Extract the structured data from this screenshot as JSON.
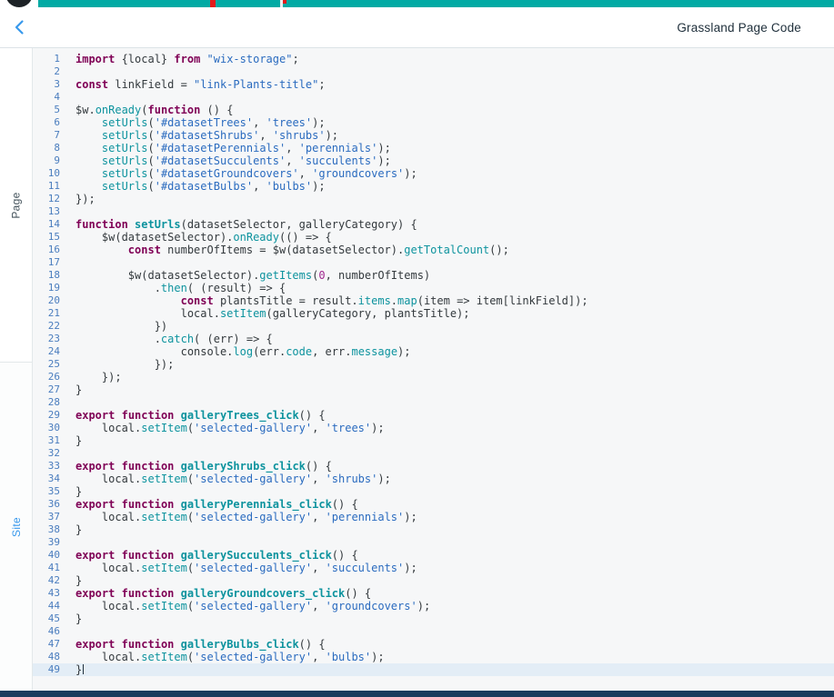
{
  "header": {
    "title": "Grassland Page Code",
    "back_icon": "chevron-left"
  },
  "sidebar": {
    "tabs": [
      {
        "label": "Page",
        "active": true
      },
      {
        "label": "Site",
        "active": false
      }
    ]
  },
  "editor": {
    "active_line": 49,
    "lines": [
      [
        [
          "k",
          "import"
        ],
        [
          "d",
          " {local} "
        ],
        [
          "k",
          "from"
        ],
        [
          "d",
          " "
        ],
        [
          "s",
          "\"wix-storage\""
        ],
        [
          "d",
          ";"
        ]
      ],
      [],
      [
        [
          "k",
          "const"
        ],
        [
          "d",
          " linkField = "
        ],
        [
          "s",
          "\"link-Plants-title\""
        ],
        [
          "d",
          ";"
        ]
      ],
      [],
      [
        [
          "d",
          "$w."
        ],
        [
          "f",
          "onReady"
        ],
        [
          "d",
          "("
        ],
        [
          "k",
          "function"
        ],
        [
          "d",
          " () {"
        ]
      ],
      [
        [
          "d",
          "    "
        ],
        [
          "f",
          "setUrls"
        ],
        [
          "d",
          "("
        ],
        [
          "s",
          "'#datasetTrees'"
        ],
        [
          "d",
          ", "
        ],
        [
          "s",
          "'trees'"
        ],
        [
          "d",
          ");"
        ]
      ],
      [
        [
          "d",
          "    "
        ],
        [
          "f",
          "setUrls"
        ],
        [
          "d",
          "("
        ],
        [
          "s",
          "'#datasetShrubs'"
        ],
        [
          "d",
          ", "
        ],
        [
          "s",
          "'shrubs'"
        ],
        [
          "d",
          ");"
        ]
      ],
      [
        [
          "d",
          "    "
        ],
        [
          "f",
          "setUrls"
        ],
        [
          "d",
          "("
        ],
        [
          "s",
          "'#datasetPerennials'"
        ],
        [
          "d",
          ", "
        ],
        [
          "s",
          "'perennials'"
        ],
        [
          "d",
          ");"
        ]
      ],
      [
        [
          "d",
          "    "
        ],
        [
          "f",
          "setUrls"
        ],
        [
          "d",
          "("
        ],
        [
          "s",
          "'#datasetSucculents'"
        ],
        [
          "d",
          ", "
        ],
        [
          "s",
          "'succulents'"
        ],
        [
          "d",
          ");"
        ]
      ],
      [
        [
          "d",
          "    "
        ],
        [
          "f",
          "setUrls"
        ],
        [
          "d",
          "("
        ],
        [
          "s",
          "'#datasetGroundcovers'"
        ],
        [
          "d",
          ", "
        ],
        [
          "s",
          "'groundcovers'"
        ],
        [
          "d",
          ");"
        ]
      ],
      [
        [
          "d",
          "    "
        ],
        [
          "f",
          "setUrls"
        ],
        [
          "d",
          "("
        ],
        [
          "s",
          "'#datasetBulbs'"
        ],
        [
          "d",
          ", "
        ],
        [
          "s",
          "'bulbs'"
        ],
        [
          "d",
          ");"
        ]
      ],
      [
        [
          "d",
          "});"
        ]
      ],
      [],
      [
        [
          "k",
          "function"
        ],
        [
          "d",
          " "
        ],
        [
          "fb",
          "setUrls"
        ],
        [
          "d",
          "(datasetSelector, galleryCategory) {"
        ]
      ],
      [
        [
          "d",
          "    $w(datasetSelector)."
        ],
        [
          "f",
          "onReady"
        ],
        [
          "d",
          "(() => {"
        ]
      ],
      [
        [
          "d",
          "        "
        ],
        [
          "k",
          "const"
        ],
        [
          "d",
          " numberOfItems = $w(datasetSelector)."
        ],
        [
          "f",
          "getTotalCount"
        ],
        [
          "d",
          "();"
        ]
      ],
      [],
      [
        [
          "d",
          "        $w(datasetSelector)."
        ],
        [
          "f",
          "getItems"
        ],
        [
          "d",
          "("
        ],
        [
          "n",
          "0"
        ],
        [
          "d",
          ", numberOfItems)"
        ]
      ],
      [
        [
          "d",
          "            ."
        ],
        [
          "f",
          "then"
        ],
        [
          "d",
          "( (result) => {"
        ]
      ],
      [
        [
          "d",
          "                "
        ],
        [
          "k",
          "const"
        ],
        [
          "d",
          " plantsTitle = result."
        ],
        [
          "f",
          "items"
        ],
        [
          "d",
          "."
        ],
        [
          "f",
          "map"
        ],
        [
          "d",
          "(item => item[linkField]);"
        ]
      ],
      [
        [
          "d",
          "                local."
        ],
        [
          "f",
          "setItem"
        ],
        [
          "d",
          "(galleryCategory, plantsTitle);"
        ]
      ],
      [
        [
          "d",
          "            })"
        ]
      ],
      [
        [
          "d",
          "            ."
        ],
        [
          "f",
          "catch"
        ],
        [
          "d",
          "( (err) => {"
        ]
      ],
      [
        [
          "d",
          "                console."
        ],
        [
          "f",
          "log"
        ],
        [
          "d",
          "(err."
        ],
        [
          "f",
          "code"
        ],
        [
          "d",
          ", err."
        ],
        [
          "f",
          "message"
        ],
        [
          "d",
          ");"
        ]
      ],
      [
        [
          "d",
          "            });"
        ]
      ],
      [
        [
          "d",
          "    });"
        ]
      ],
      [
        [
          "d",
          "}"
        ]
      ],
      [],
      [
        [
          "k",
          "export"
        ],
        [
          "d",
          " "
        ],
        [
          "k",
          "function"
        ],
        [
          "d",
          " "
        ],
        [
          "fb",
          "galleryTrees_click"
        ],
        [
          "d",
          "() {"
        ]
      ],
      [
        [
          "d",
          "    local."
        ],
        [
          "f",
          "setItem"
        ],
        [
          "d",
          "("
        ],
        [
          "s",
          "'selected-gallery'"
        ],
        [
          "d",
          ", "
        ],
        [
          "s",
          "'trees'"
        ],
        [
          "d",
          ");"
        ]
      ],
      [
        [
          "d",
          "}"
        ]
      ],
      [],
      [
        [
          "k",
          "export"
        ],
        [
          "d",
          " "
        ],
        [
          "k",
          "function"
        ],
        [
          "d",
          " "
        ],
        [
          "fb",
          "galleryShrubs_click"
        ],
        [
          "d",
          "() {"
        ]
      ],
      [
        [
          "d",
          "    local."
        ],
        [
          "f",
          "setItem"
        ],
        [
          "d",
          "("
        ],
        [
          "s",
          "'selected-gallery'"
        ],
        [
          "d",
          ", "
        ],
        [
          "s",
          "'shrubs'"
        ],
        [
          "d",
          ");"
        ]
      ],
      [
        [
          "d",
          "}"
        ]
      ],
      [
        [
          "k",
          "export"
        ],
        [
          "d",
          " "
        ],
        [
          "k",
          "function"
        ],
        [
          "d",
          " "
        ],
        [
          "fb",
          "galleryPerennials_click"
        ],
        [
          "d",
          "() {"
        ]
      ],
      [
        [
          "d",
          "    local."
        ],
        [
          "f",
          "setItem"
        ],
        [
          "d",
          "("
        ],
        [
          "s",
          "'selected-gallery'"
        ],
        [
          "d",
          ", "
        ],
        [
          "s",
          "'perennials'"
        ],
        [
          "d",
          ");"
        ]
      ],
      [
        [
          "d",
          "}"
        ]
      ],
      [],
      [
        [
          "k",
          "export"
        ],
        [
          "d",
          " "
        ],
        [
          "k",
          "function"
        ],
        [
          "d",
          " "
        ],
        [
          "fb",
          "gallerySucculents_click"
        ],
        [
          "d",
          "() {"
        ]
      ],
      [
        [
          "d",
          "    local."
        ],
        [
          "f",
          "setItem"
        ],
        [
          "d",
          "("
        ],
        [
          "s",
          "'selected-gallery'"
        ],
        [
          "d",
          ", "
        ],
        [
          "s",
          "'succulents'"
        ],
        [
          "d",
          ");"
        ]
      ],
      [
        [
          "d",
          "}"
        ]
      ],
      [
        [
          "k",
          "export"
        ],
        [
          "d",
          " "
        ],
        [
          "k",
          "function"
        ],
        [
          "d",
          " "
        ],
        [
          "fb",
          "galleryGroundcovers_click"
        ],
        [
          "d",
          "() {"
        ]
      ],
      [
        [
          "d",
          "    local."
        ],
        [
          "f",
          "setItem"
        ],
        [
          "d",
          "("
        ],
        [
          "s",
          "'selected-gallery'"
        ],
        [
          "d",
          ", "
        ],
        [
          "s",
          "'groundcovers'"
        ],
        [
          "d",
          ");"
        ]
      ],
      [
        [
          "d",
          "}"
        ]
      ],
      [],
      [
        [
          "k",
          "export"
        ],
        [
          "d",
          " "
        ],
        [
          "k",
          "function"
        ],
        [
          "d",
          " "
        ],
        [
          "fb",
          "galleryBulbs_click"
        ],
        [
          "d",
          "() {"
        ]
      ],
      [
        [
          "d",
          "    local."
        ],
        [
          "f",
          "setItem"
        ],
        [
          "d",
          "("
        ],
        [
          "s",
          "'selected-gallery'"
        ],
        [
          "d",
          ", "
        ],
        [
          "s",
          "'bulbs'"
        ],
        [
          "d",
          ");"
        ]
      ],
      [
        [
          "d",
          "}"
        ]
      ]
    ]
  },
  "colors": {
    "accent_teal": "#00aaa4",
    "marker_red": "#e21b1b",
    "title_text": "#20303c",
    "back_arrow_blue": "#3899ec",
    "site_tab_blue": "#3899ec",
    "editor_bg": "#f6f7f8",
    "line_number": "#4a7dbe",
    "keyword": "#7f0055",
    "string": "#2a6bbf",
    "function_name": "#0d939e",
    "number": "#a0268e",
    "default_text": "#33393d",
    "bottom_bar": "#1b3c5e"
  }
}
